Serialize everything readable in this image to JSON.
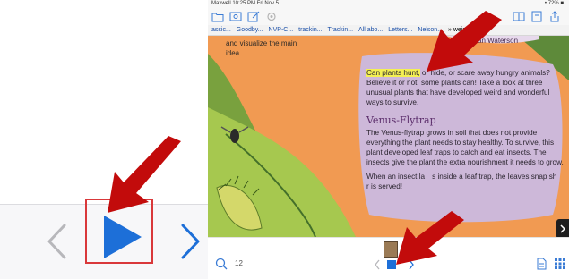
{
  "status_bar": {
    "left": "Maxwell  10:25 PM  Fri Nov 5",
    "right": "• 72% ■"
  },
  "bookmarks": [
    "assic...",
    "Goodby...",
    "NVP-C...",
    "trackin...",
    "Trackin...",
    "All abo...",
    "Letters...",
    "Nelson...",
    "» weir..."
  ],
  "book": {
    "intro": "and visualize the main idea.",
    "author": "an Waterson",
    "highlight": "Can plants hunt,",
    "paragraph1": " or hide, or scare away hungry animals? Believe it or not, some plants can! Take a look at three unusual plants that have developed weird and wonderful ways to survive.",
    "heading": "Venus-Flytrap",
    "paragraph2": "The Venus-flytrap grows in soil that does not provide everything the plant needs to stay healthy. To survive, this plant developed leaf traps to catch and eat insects. The insects give the plant the extra nourishment it needs to grow.",
    "paragraph3_a": "When an insect la",
    "paragraph3_b": "s inside a leaf trap, the leaves snap sh",
    "paragraph3_c": "r is served!"
  },
  "bottom_bar": {
    "page_number": "12"
  },
  "colors": {
    "accent": "#1d6fd8",
    "highlight_box": "#d9383a",
    "arrow": "#c20b0b",
    "page_orange": "#f19a52",
    "text_box": "#cdb8d9"
  }
}
